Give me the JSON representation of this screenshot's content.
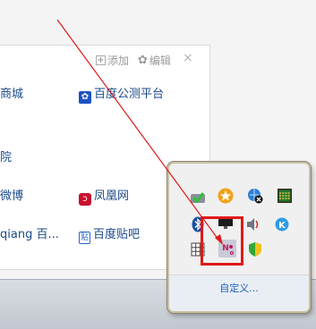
{
  "panel": {
    "add_label": "添加",
    "edit_label": "编辑",
    "close_label": "×",
    "links": [
      {
        "text": "商城"
      },
      {
        "text": "百度公测平台"
      },
      {
        "text": "院"
      },
      {
        "text": "微博"
      },
      {
        "text": "凤凰网"
      },
      {
        "text": "qiang 百..."
      },
      {
        "text": "百度贴吧"
      }
    ]
  },
  "tray_popup": {
    "customize_label": "自定义...",
    "icons": [
      {
        "name": "green-check-shield-icon"
      },
      {
        "name": "orange-star-icon"
      },
      {
        "name": "network-globe-icon"
      },
      {
        "name": "abacus-icon"
      },
      {
        "name": "bluetooth-icon"
      },
      {
        "name": "display-icon"
      },
      {
        "name": "speaker-icon"
      },
      {
        "name": "k-circle-icon"
      },
      {
        "name": "grid-icon"
      },
      {
        "name": "ntfs-no-icon"
      },
      {
        "name": "security-shield-icon"
      }
    ]
  },
  "colors": {
    "highlight": "#e01818",
    "arrow": "#e01818",
    "link": "#1a4a8a",
    "customize_link": "#1a5fb4"
  }
}
